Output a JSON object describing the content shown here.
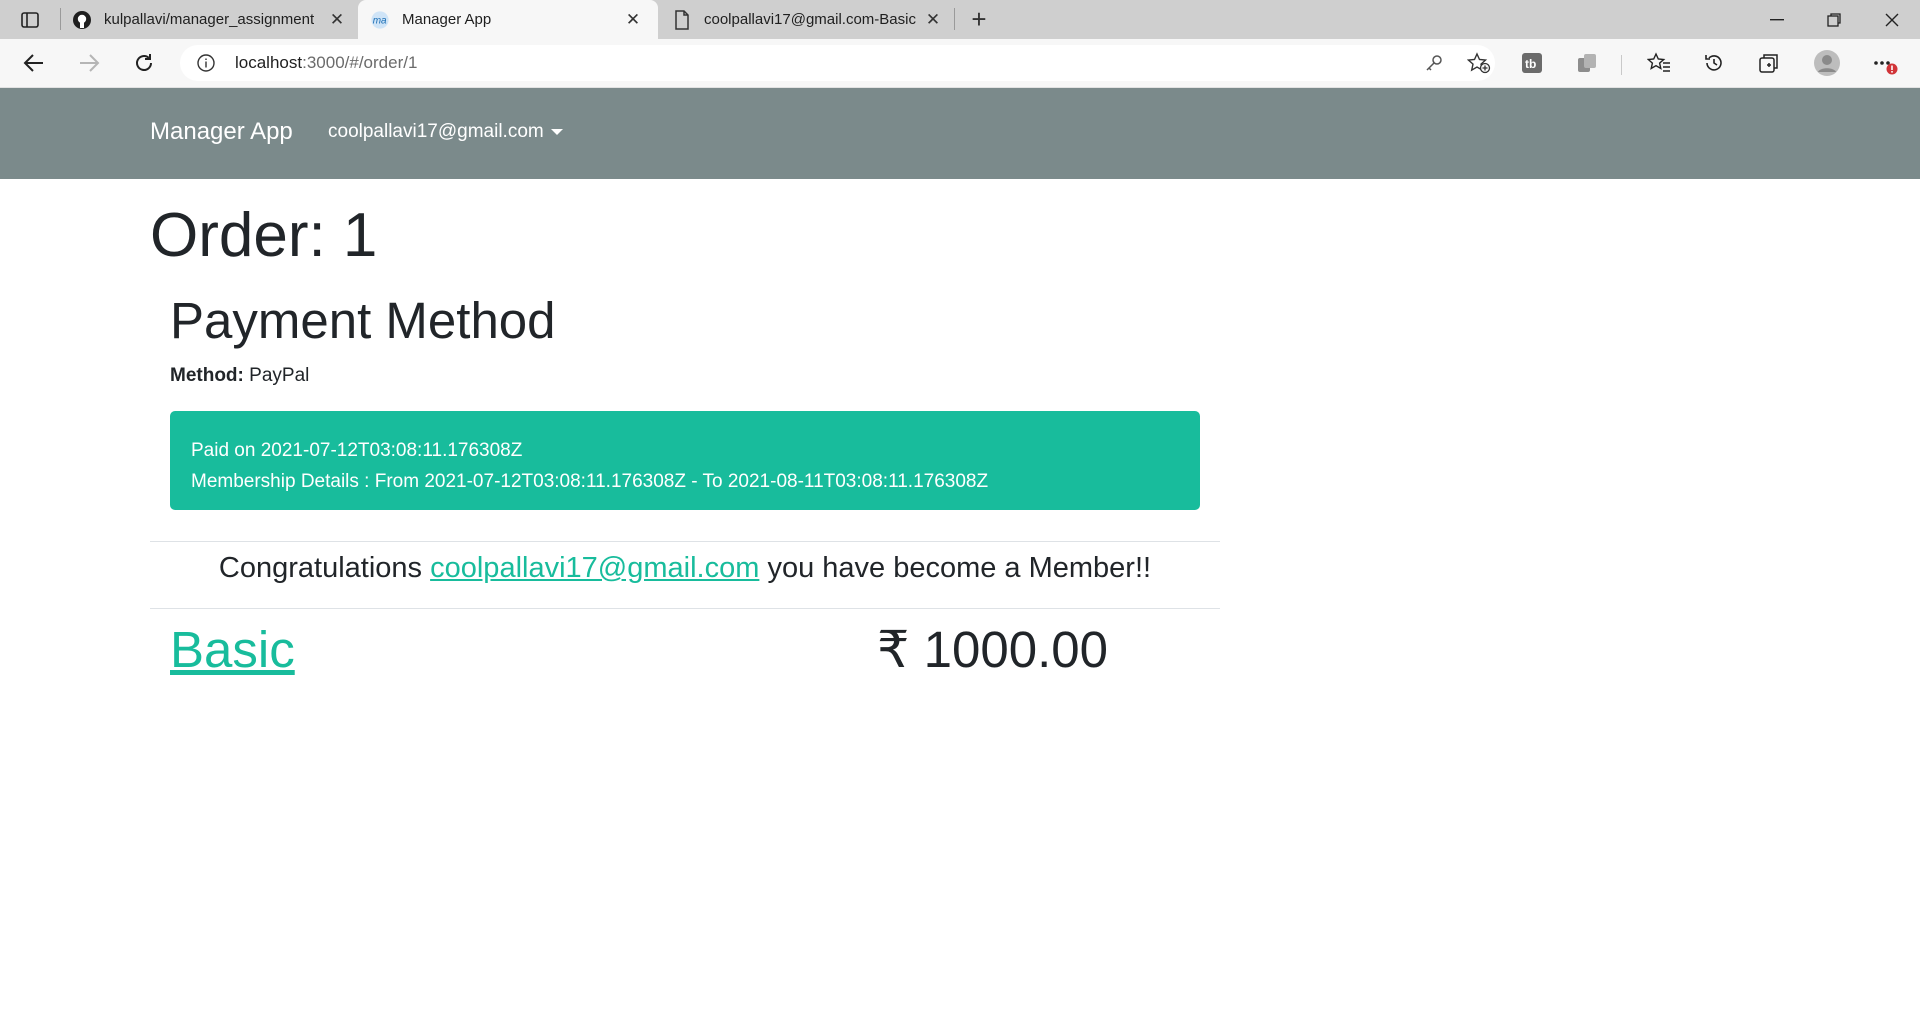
{
  "browser": {
    "tabs": [
      {
        "title": "kulpallavi/manager_assignment",
        "icon": "github-icon",
        "active": false
      },
      {
        "title": "Manager App",
        "icon": "manager-app-icon",
        "active": true
      },
      {
        "title": "coolpallavi17@gmail.com-Basic",
        "icon": "document-icon",
        "active": false
      }
    ],
    "address": {
      "host": "localhost",
      "path": ":3000/#/order/1"
    },
    "colors": {
      "tabstrip": "#cfcfcf",
      "toolbar": "#f7f7f7"
    }
  },
  "app": {
    "brand": "Manager App",
    "user_email": "coolpallavi17@gmail.com",
    "navbar_color": "#7b8a8b",
    "accent_color": "#18bc9c"
  },
  "order": {
    "title": "Order: 1",
    "payment_section_title": "Payment Method",
    "method_label": "Method:",
    "method_value": "PayPal",
    "paid_on": "Paid on 2021-07-12T03:08:11.176308Z",
    "membership_details": "Membership Details : From 2021-07-12T03:08:11.176308Z - To 2021-08-11T03:08:11.176308Z",
    "congrats_prefix": "Congratulations",
    "congrats_email": "coolpallavi17@gmail.com",
    "congrats_suffix": "you have become a Member!!",
    "plan_name": "Basic",
    "price": "₹ 1000.00"
  }
}
